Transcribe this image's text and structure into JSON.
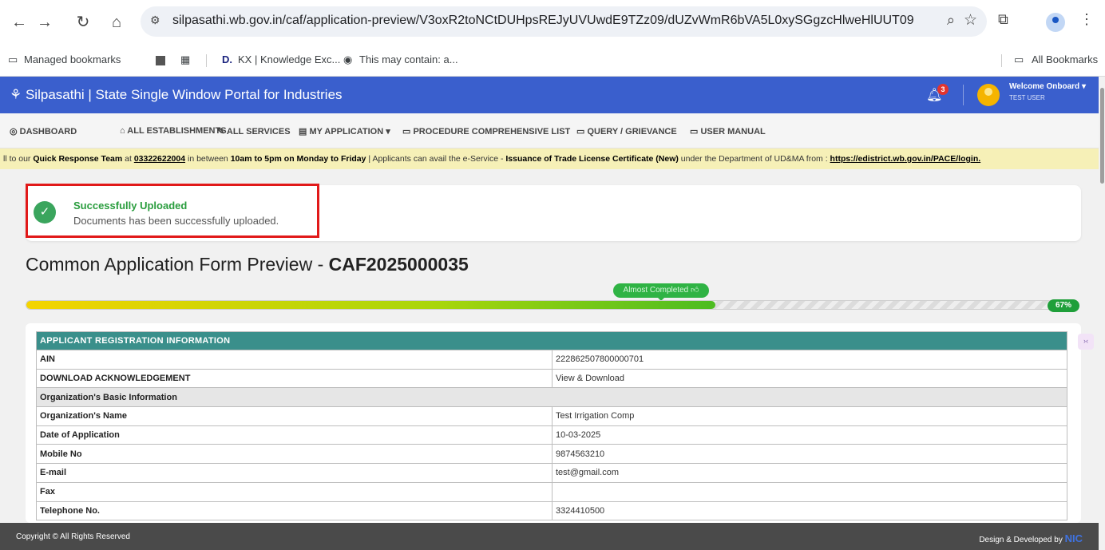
{
  "browser": {
    "url": "silpasathi.wb.gov.in/caf/application-preview/V3oxR2toNCtDUHpsREJyUVUwdE9TZz09/dUZvWmR6bVA5L0xySGgzcHlweHlUUT09",
    "bookmarks": [
      "Managed bookmarks",
      "KX | Knowledge Exc...",
      "This may contain: a..."
    ],
    "all_bookmarks": "All Bookmarks"
  },
  "portal": {
    "title": "Silpasathi | State Single Window Portal for Industries",
    "notification_count": "3",
    "welcome": "Welcome Onboard",
    "user": "TEST USER"
  },
  "menu": [
    "DASHBOARD",
    "ALL ESTABLISHMENTS",
    "ALL SERVICES",
    "MY APPLICATION",
    "PROCEDURE COMPREHENSIVE LIST",
    "QUERY / GRIEVANCE",
    "USER MANUAL"
  ],
  "ticker": {
    "t1": "ll to our ",
    "t2": "Quick Response Team",
    "t3": " at ",
    "phone": "03322622004",
    "t4": " in between ",
    "hours": "10am to 5pm on Monday to Friday",
    "t5": "   |   Applicants can avail the e-Service - ",
    "service": "Issuance of Trade License Certificate (New)",
    "t6": " under the Department of UD&MA from : ",
    "link": "https://edistrict.wb.gov.in/PACE/login."
  },
  "alert": {
    "title": "Successfully Uploaded",
    "message": "Documents has been successfully uploaded."
  },
  "form": {
    "title_prefix": "Common Application Form Preview - ",
    "caf_id": "CAF2025000035"
  },
  "progress": {
    "label": "Almost Completed",
    "percent_text": "67%",
    "value": 0.67
  },
  "table": {
    "header": "APPLICANT REGISTRATION INFORMATION",
    "rows": [
      {
        "k": "AIN",
        "v": "222862507800000701",
        "caps": true
      },
      {
        "k": "DOWNLOAD ACKNOWLEDGEMENT",
        "v": "View & Download",
        "caps": true
      },
      {
        "section": "Organization's Basic Information"
      },
      {
        "k": "Organization's Name",
        "v": "Test Irrigation Comp"
      },
      {
        "k": "Date of Application",
        "v": "10-03-2025"
      },
      {
        "k": "Mobile No",
        "v": "9874563210"
      },
      {
        "k": "E-mail",
        "v": "test@gmail.com"
      },
      {
        "k": "Fax",
        "v": ""
      },
      {
        "k": "Telephone No.",
        "v": "3324410500"
      }
    ]
  },
  "footer": {
    "left": "Copyright © All Rights Reserved",
    "right": "Design & Developed by",
    "brand": "NIC"
  },
  "icons": {
    "back": "arrow-left-icon",
    "forward": "arrow-right-icon",
    "reload": "reload-icon",
    "home": "home-icon",
    "bell": "bell-icon",
    "check": "check-circle-icon"
  },
  "colors": {
    "portal_header": "#3a5fcd",
    "table_header": "#3a8f8b",
    "success": "#2a9d3e",
    "alert_border": "#e11919",
    "ticker_bg": "#f6f0b7"
  }
}
